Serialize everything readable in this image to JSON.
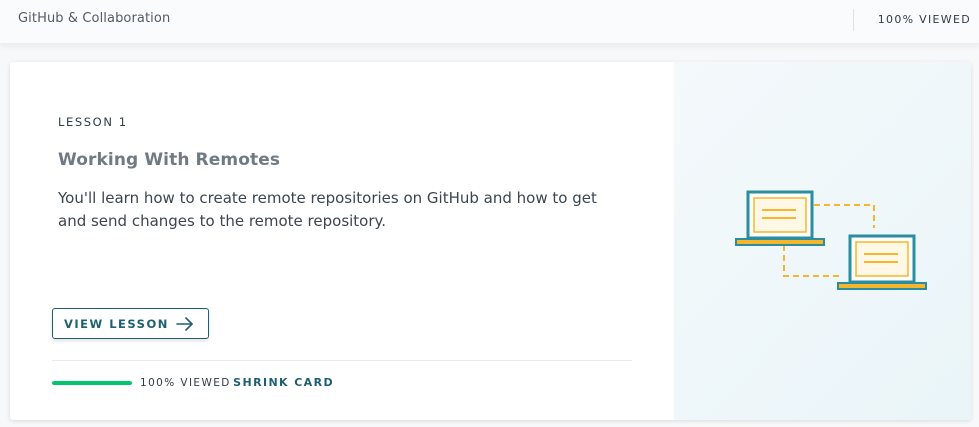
{
  "topbar": {
    "title": "GitHub & Collaboration",
    "progress_label": "100% VIEWED"
  },
  "card": {
    "lesson_number": "LESSON 1",
    "lesson_title": "Working With Remotes",
    "description": "You'll learn how to create remote repositories on GitHub and how to get and send changes to the remote repository.",
    "view_button_label": "VIEW LESSON",
    "view_button_icon": "arrow-right-icon",
    "progress": {
      "fraction": 1.0,
      "label": "100% VIEWED"
    },
    "shrink_label": "SHRINK CARD",
    "illustration_icon": "laptops-sync-illustration"
  },
  "colors": {
    "accent": "#1f5f73",
    "progress": "#02c66e",
    "illustration_teal": "#2b8ea0",
    "illustration_yellow": "#f7b52c"
  }
}
